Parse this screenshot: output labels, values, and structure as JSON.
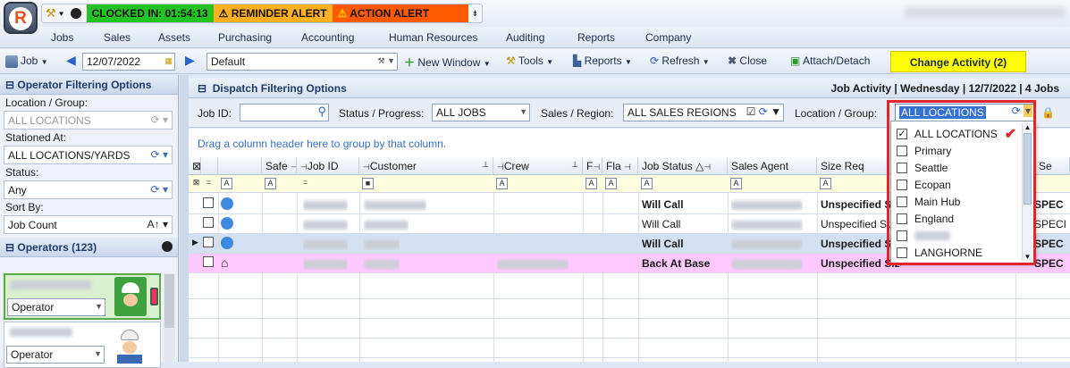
{
  "title_bar": {
    "logo_letter": "R",
    "clocked_in": "CLOCKED IN: 01:54:13",
    "reminder_alert": "REMINDER ALERT",
    "action_alert": "ACTION ALERT"
  },
  "menu": [
    "Jobs",
    "Sales",
    "Assets",
    "Purchasing",
    "Accounting",
    "Human Resources",
    "Auditing",
    "Reports",
    "Company"
  ],
  "toolbar": {
    "job": "Job",
    "date": "12/07/2022",
    "layout": "Default",
    "new_window": "New Window",
    "tools": "Tools",
    "reports": "Reports",
    "refresh": "Refresh",
    "close": "Close",
    "attach_detach": "Attach/Detach",
    "change_activity": "Change Activity (2)"
  },
  "left_panel": {
    "header": "Operator Filtering Options",
    "location_label": "Location / Group:",
    "location_value": "ALL LOCATIONS",
    "stationed_label": "Stationed At:",
    "stationed_value": "ALL LOCATIONS/YARDS",
    "status_label": "Status:",
    "status_value": "Any",
    "sort_label": "Sort By:",
    "sort_value": "Job Count",
    "operators_header": "Operators (123)",
    "operator_role_1": "Operator",
    "operator_role_2": "Operator"
  },
  "dispatch": {
    "header": "Dispatch Filtering Options",
    "job_activity": "Job Activity | Wednesday | 12/7/2022 | 4 Jobs",
    "job_id_label": "Job ID:",
    "status_label": "Status / Progress:",
    "status_value": "ALL JOBS",
    "sales_label": "Sales / Region:",
    "sales_value": "ALL SALES REGIONS",
    "location_label": "Location / Group:",
    "location_value": "ALL LOCATIONS",
    "group_hint": "Drag a column header here to group by that column."
  },
  "columns": [
    "Safe",
    "Job ID",
    "Customer",
    "Crew",
    "F",
    "Fla",
    "Job Status",
    "Sales Agent",
    "Size Req",
    "Se"
  ],
  "rows": [
    {
      "status": "Will Call",
      "size": "Unspecified Size",
      "spec": "SPEC",
      "bold": true
    },
    {
      "status": "Will Call",
      "size": "Unspecified Size",
      "spec": "SPECI",
      "bold": false
    },
    {
      "status": "Will Call",
      "size": "Unspecified Size",
      "spec": "SPEC",
      "bold": true
    },
    {
      "status": "Back At Base",
      "size": "Unspecified Size",
      "spec": "SPEC",
      "bold": true
    }
  ],
  "location_options": [
    {
      "label": "ALL LOCATIONS",
      "checked": true
    },
    {
      "label": "Primary",
      "checked": false
    },
    {
      "label": "Seattle",
      "checked": false
    },
    {
      "label": "Ecopan",
      "checked": false
    },
    {
      "label": "Main Hub",
      "checked": false
    },
    {
      "label": "England",
      "checked": false
    },
    {
      "label": "",
      "checked": false
    },
    {
      "label": "LANGHORNE",
      "checked": false
    }
  ],
  "colors": {
    "clocked_in": "#22c322",
    "reminder": "#ffb020",
    "action": "#ff5a00",
    "change_activity": "#ffff00",
    "highlight_row": "#ffc8ff",
    "selected_row": "#d3e0f1",
    "red_outline": "#e0252b"
  }
}
